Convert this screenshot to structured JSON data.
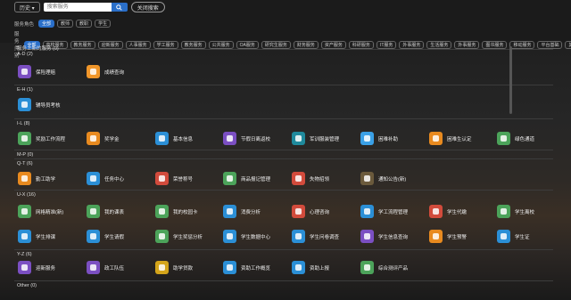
{
  "search": {
    "history_label": "历史 ▾",
    "placeholder": "搜索服务",
    "close_label": "关闭搜索"
  },
  "filters": {
    "dept_label": "服务角色",
    "dept": [
      "全部",
      "教师",
      "教职",
      "学生"
    ],
    "cat_label": "服务类别",
    "cat": [
      "全部",
      "高校服务",
      "教务服务",
      "迎新服务",
      "人事服务",
      "学工服务",
      "教务服务",
      "公共服务",
      "OA服务",
      "研究生服务",
      "财务服务",
      "资产服务",
      "科研服务",
      "IT服务",
      "外事服务",
      "生活服务",
      "外事服务",
      "图书服务",
      "移动服务",
      "平台基础",
      "其他服务"
    ]
  },
  "recommend_label": "服务上新的服务 (0)",
  "groups": [
    {
      "title": "A-D (2)",
      "items": [
        {
          "label": "保险理赔",
          "color": "#7b4fc2"
        },
        {
          "label": "成绩查询",
          "color": "#f0962a"
        }
      ]
    },
    {
      "title": "E-H (1)",
      "items": [
        {
          "label": "辅导员考核",
          "color": "#2b8fd6"
        }
      ]
    },
    {
      "title": "I-L (8)",
      "items": [
        {
          "label": "奖励工作流程",
          "color": "#4ca35a"
        },
        {
          "label": "奖学金",
          "color": "#e88a1f"
        },
        {
          "label": "基本信息",
          "color": "#2b8fd6"
        },
        {
          "label": "节假日离返校",
          "color": "#7b4fc2"
        },
        {
          "label": "军训服装管理",
          "color": "#1f8a9c"
        },
        {
          "label": "困难补助",
          "color": "#3aa0e6"
        },
        {
          "label": "困难生认定",
          "color": "#e88a1f"
        },
        {
          "label": "绿色通道",
          "color": "#4ca35a"
        }
      ]
    },
    {
      "title": "M-P (0)",
      "items": []
    },
    {
      "title": "Q-T (6)",
      "items": [
        {
          "label": "勤工助学",
          "color": "#e88a1f"
        },
        {
          "label": "任务中心",
          "color": "#2b8fd6"
        },
        {
          "label": "荣誉称号",
          "color": "#d24b3c"
        },
        {
          "label": "商品报记管理",
          "color": "#4ca35a"
        },
        {
          "label": "失物招领",
          "color": "#d24b3c"
        },
        {
          "label": "通知公告(新)",
          "color": "#6b5a3c"
        }
      ]
    },
    {
      "title": "U-X (16)",
      "items": [
        {
          "label": "网格精准(新)",
          "color": "#4ca35a"
        },
        {
          "label": "我的课表",
          "color": "#4ca35a"
        },
        {
          "label": "我的校园卡",
          "color": "#4ca35a"
        },
        {
          "label": "消费分析",
          "color": "#2b8fd6"
        },
        {
          "label": "心理咨询",
          "color": "#d24b3c"
        },
        {
          "label": "学工流程管理",
          "color": "#2b8fd6"
        },
        {
          "label": "学生代缴",
          "color": "#d24b3c"
        },
        {
          "label": "学生离校",
          "color": "#4ca35a"
        },
        {
          "label": "学生排课",
          "color": "#2b8fd6"
        },
        {
          "label": "学生请假",
          "color": "#2b8fd6"
        },
        {
          "label": "学生奖惩分析",
          "color": "#4ca35a"
        },
        {
          "label": "学生数据中心",
          "color": "#2b8fd6"
        },
        {
          "label": "学生问卷调查",
          "color": "#2b8fd6"
        },
        {
          "label": "学生信息查询",
          "color": "#7b4fc2"
        },
        {
          "label": "学生预警",
          "color": "#e88a1f"
        },
        {
          "label": "学生证",
          "color": "#2b8fd6"
        }
      ]
    },
    {
      "title": "Y-Z (6)",
      "items": [
        {
          "label": "迎新服务",
          "color": "#7b4fc2"
        },
        {
          "label": "政工队伍",
          "color": "#7b4fc2"
        },
        {
          "label": "助学贷款",
          "color": "#d4a41a"
        },
        {
          "label": "资助工作概览",
          "color": "#2b8fd6"
        },
        {
          "label": "资助上报",
          "color": "#2b8fd6"
        },
        {
          "label": "综合测评产品",
          "color": "#4ca35a"
        }
      ]
    },
    {
      "title": "Other (0)",
      "items": []
    }
  ]
}
